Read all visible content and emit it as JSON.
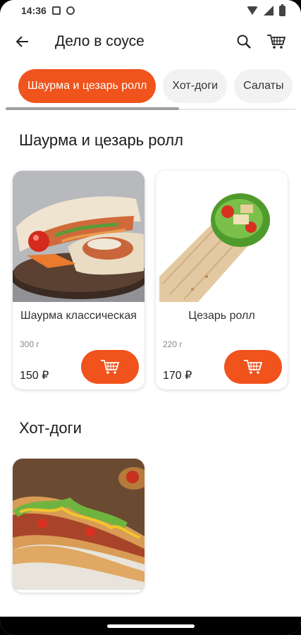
{
  "status": {
    "time": "14:36"
  },
  "appbar": {
    "title": "Дело в соусе",
    "back_icon": "arrow-back-icon",
    "search_icon": "search-icon",
    "cart_icon": "cart-icon"
  },
  "tabs": [
    {
      "label": "Шаурма и цезарь ролл",
      "active": true
    },
    {
      "label": "Хот-доги",
      "active": false
    },
    {
      "label": "Салаты",
      "active": false
    }
  ],
  "sections": [
    {
      "title": "Шаурма и цезарь ролл",
      "products": [
        {
          "name": "Шаурма классическая",
          "weight": "300 г",
          "price": "150 ₽"
        },
        {
          "name": "Цезарь ролл",
          "weight": "220 г",
          "price": "170 ₽"
        }
      ]
    },
    {
      "title": "Хот-доги",
      "products": []
    }
  ],
  "colors": {
    "accent": "#f0531c",
    "tab_inactive": "#f2f2f2"
  }
}
